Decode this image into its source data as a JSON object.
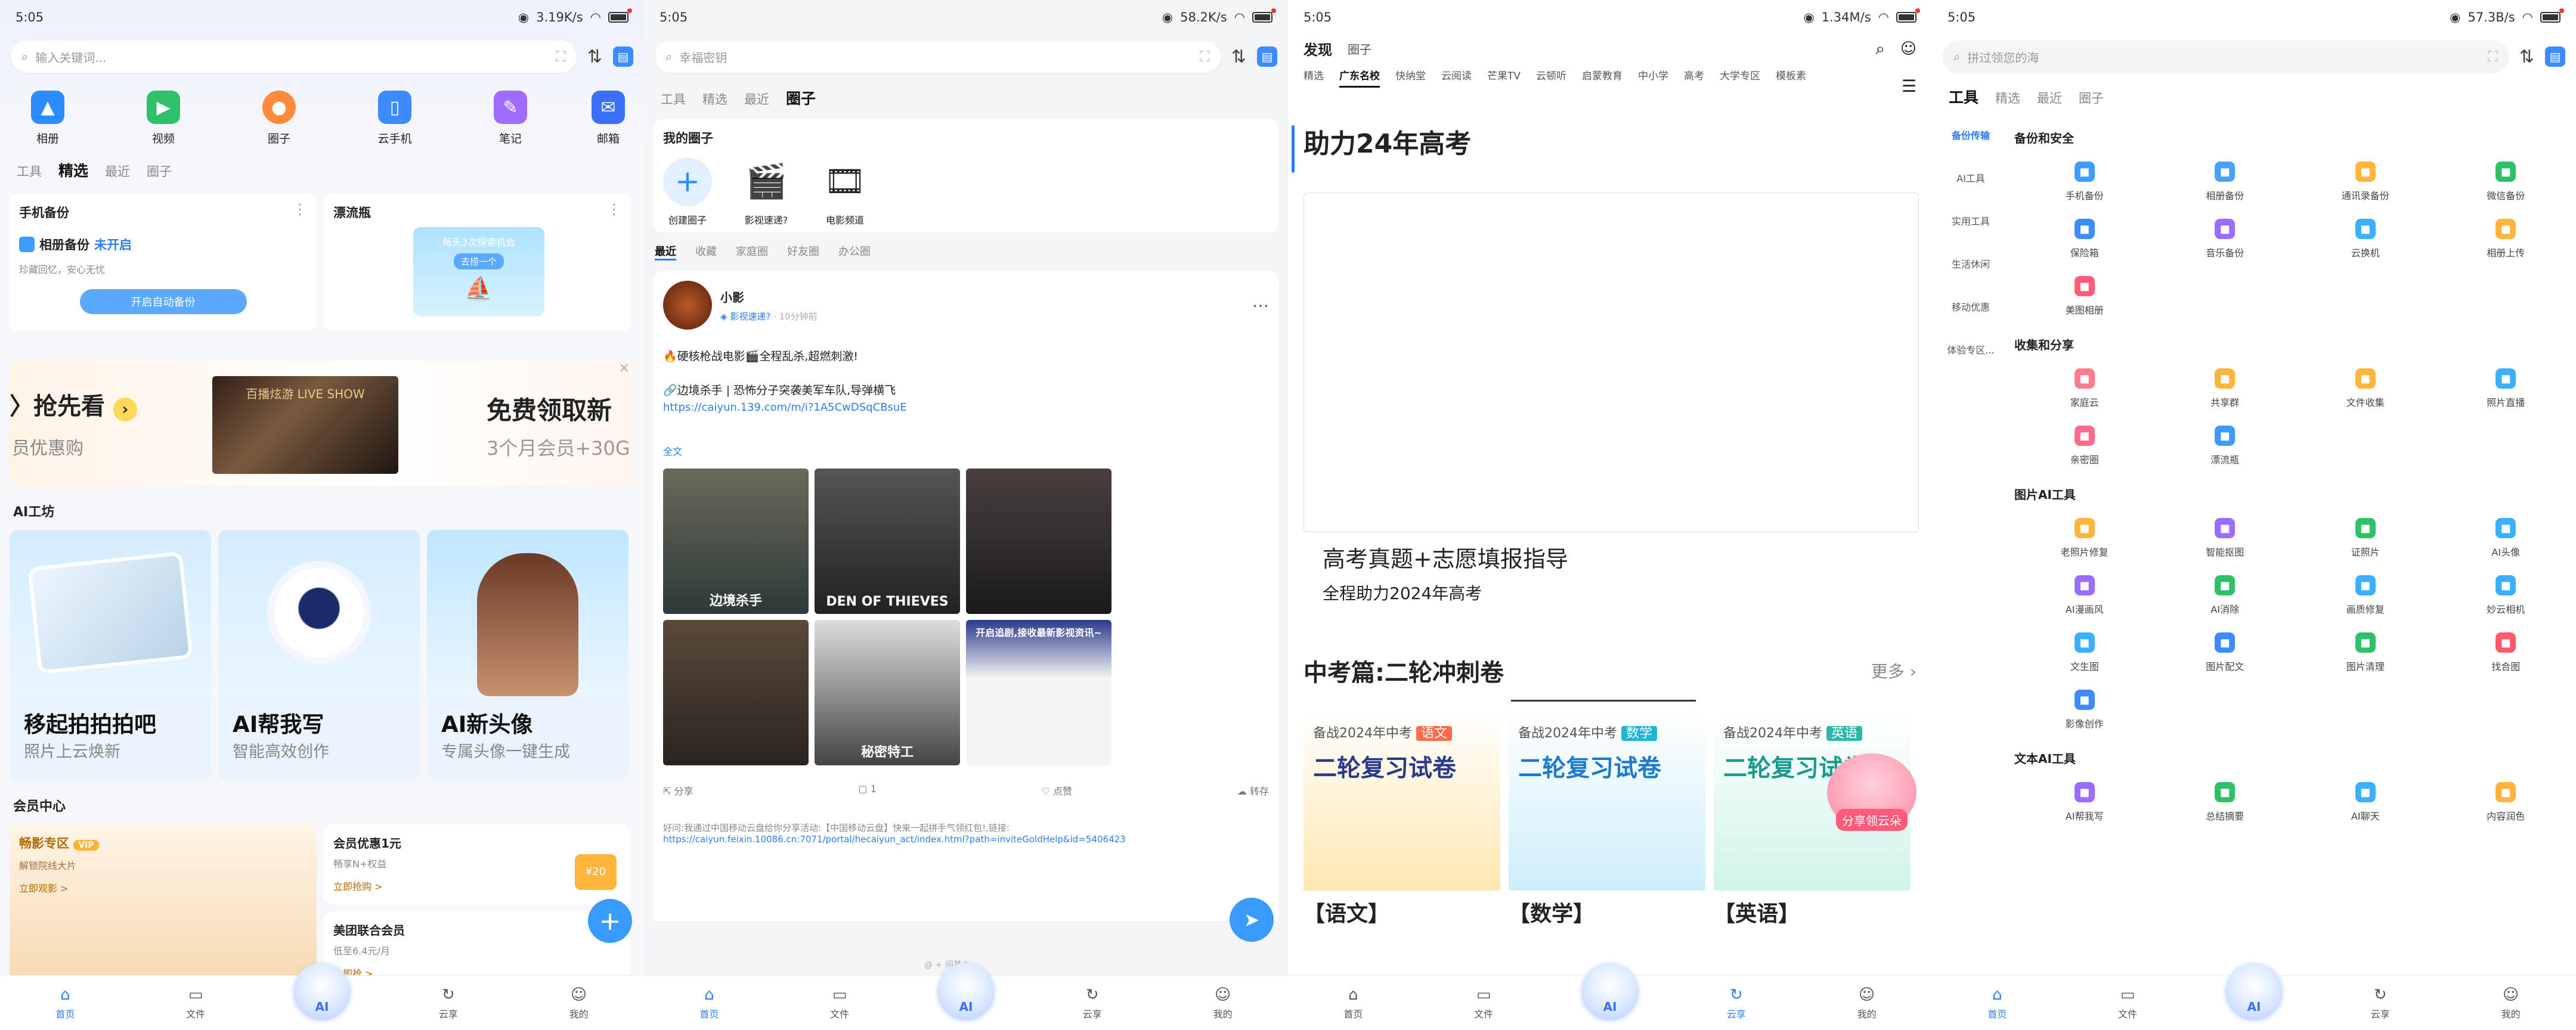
{
  "panels": [
    {
      "status": {
        "time": "5:05",
        "net": "3.19K/s"
      },
      "search": {
        "placeholder": "输入关键词..."
      },
      "quick": [
        {
          "label": "相册",
          "icon": "photo-icon",
          "color": "#2b8cff"
        },
        {
          "label": "视频",
          "icon": "video-icon",
          "color": "#2fc16a"
        },
        {
          "label": "圈子",
          "icon": "circle-icon",
          "color": "#ff8a3c"
        },
        {
          "label": "云手机",
          "icon": "cloud-phone-icon",
          "color": "#3e8bff"
        },
        {
          "label": "笔记",
          "icon": "note-icon",
          "color": "#a06cff"
        },
        {
          "label": "邮箱",
          "icon": "mail-icon",
          "color": "#3b6ff5"
        }
      ],
      "tabs": [
        "工具",
        "精选",
        "最近",
        "圈子"
      ],
      "backup": {
        "title": "手机备份",
        "line1": "相册备份",
        "status": "未开启",
        "line2": "珍藏回忆，安心无忧",
        "button": "开启自动备份"
      },
      "drift": {
        "title": "漂流瓶",
        "tip": "每天3次探索机会",
        "go": "去捞一个"
      },
      "banner": {
        "left": "抢先看",
        "left_sub": "员优惠购",
        "poster": "百播炫游 LIVE SHOW",
        "right": "免费领取新",
        "right_sub": "3个月会员+30G"
      },
      "ai_title": "AI工坊",
      "ai_cards": [
        {
          "title": "移起拍拍拍吧",
          "sub": "照片上云焕新"
        },
        {
          "title": "AI帮我写",
          "sub": "智能高效创作"
        },
        {
          "title": "AI新头像",
          "sub": "专属头像一键生成"
        }
      ],
      "member_title": "会员中心",
      "member": {
        "vip": "畅影专区",
        "vip_badge": "VIP",
        "vip_sub": "解锁院线大片",
        "vip_link": "立即观影 >",
        "offer1": "会员优惠1元",
        "offer1_sub": "畅享N+权益",
        "offer1_link": "立即抢购 >",
        "offer2": "美团联合会员",
        "offer2_sub": "低至6.4元/月",
        "offer2_link": "立即抢 >",
        "offer1_badge": "¥20"
      }
    },
    {
      "status": {
        "time": "5:05",
        "net": "58.2K/s"
      },
      "search": {
        "placeholder": "幸福密钥"
      },
      "tabs": [
        "工具",
        "精选",
        "最近",
        "圈子"
      ],
      "mine_title": "我的圈子",
      "circles": [
        {
          "label": "创建圈子"
        },
        {
          "label": "影视速递?"
        },
        {
          "label": "电影频道"
        }
      ],
      "subtabs": [
        "最近",
        "收藏",
        "家庭圈",
        "好友圈",
        "办公圈"
      ],
      "post": {
        "user": "小影",
        "source": "影视速递?",
        "time": "· 10分钟前",
        "line1": "🔥硬核枪战电影🎬全程乱杀,超燃刺激!",
        "line2": "🔗边境杀手 | 恐怖分子突袭美军车队,导弹横飞",
        "link": "https://caiyun.139.com/m/i?1A5CwDSqCBsuE",
        "expand": "全文",
        "images": [
          "边境杀手",
          "DEN OF THIEVES",
          "",
          "",
          "秘密特工",
          "开启追剧,接收最新影视资讯~"
        ],
        "share": "分享",
        "comments": "1",
        "likes": "点赞",
        "forward": "转存",
        "invite": "好问:我通过中国移动云盘给你分享活动:【中国移动云盘】快来一起拼手气领红包!,链接:",
        "invite_link": "https://caiyun.feixin.10086.cn:7071/portal/hecaiyun_act/index.html?path=inviteGoldHelp&id=5406423"
      },
      "toast": "@ + 问某Ａ"
    },
    {
      "status": {
        "time": "5:05",
        "net": "1.34M/s"
      },
      "top": {
        "title": "发现",
        "sub": "圈子"
      },
      "tabs": [
        "精选",
        "广东名校",
        "快纳堂",
        "云阅读",
        "芒果TV",
        "云顿听",
        "启蒙教育",
        "中小学",
        "高考",
        "大学专区",
        "模板素"
      ],
      "active_tab": 1,
      "hero_title": "助力24年高考",
      "hero_card_title": "高考真题+志愿填报指导",
      "hero_card_sub": "全程助力2024年高考",
      "mid_title": "中考篇:二轮冲刺卷",
      "more": "更多",
      "books": [
        {
          "top": "备战2024年中考",
          "tag": "语文",
          "title": "二轮复习试卷",
          "name": "【语文】",
          "color": "#ff6a4a"
        },
        {
          "top": "备战2024年中考",
          "tag": "数学",
          "title": "二轮复习试卷",
          "name": "【数学】",
          "color": "#1fb5d6"
        },
        {
          "top": "备战2024年中考",
          "tag": "英语",
          "title": "二轮复习试卷",
          "name": "【英语】",
          "color": "#2fb6a8"
        }
      ],
      "share_badge": "分享领云朵"
    },
    {
      "status": {
        "time": "5:05",
        "net": "57.3B/s"
      },
      "search": {
        "placeholder": "拼过领您的海"
      },
      "tabs": [
        "工具",
        "精选",
        "最近",
        "圈子"
      ],
      "side": [
        "备份传输",
        "AI工具",
        "实用工具",
        "生活休闲",
        "移动优惠",
        "体验专区..."
      ],
      "groups": [
        {
          "title": "备份和安全",
          "items": [
            {
              "label": "手机备份",
              "icon": "phone-backup-icon",
              "color": "#3e9bff"
            },
            {
              "label": "相册备份",
              "icon": "album-backup-icon",
              "color": "#4aa0ff"
            },
            {
              "label": "通讯录备份",
              "icon": "contacts-icon",
              "color": "#ffb43c"
            },
            {
              "label": "微信备份",
              "icon": "wechat-icon",
              "color": "#2fc16a"
            },
            {
              "label": "保险箱",
              "icon": "safe-icon",
              "color": "#3e8bff"
            },
            {
              "label": "音乐备份",
              "icon": "music-icon",
              "color": "#9a6cff"
            },
            {
              "label": "云换机",
              "icon": "switch-icon",
              "color": "#3ab0ff"
            },
            {
              "label": "相册上传",
              "icon": "upload-icon",
              "color": "#ffb43c"
            },
            {
              "label": "美图相册",
              "icon": "beauty-icon",
              "color": "#ff5a7a"
            }
          ]
        },
        {
          "title": "收集和分享",
          "items": [
            {
              "label": "家庭云",
              "icon": "family-icon",
              "color": "#ff7a8a"
            },
            {
              "label": "共享群",
              "icon": "group-icon",
              "color": "#ffb43c"
            },
            {
              "label": "文件收集",
              "icon": "collect-icon",
              "color": "#ffb43c"
            },
            {
              "label": "照片直播",
              "icon": "live-icon",
              "color": "#3ab0ff"
            },
            {
              "label": "亲密圈",
              "icon": "heart-icon",
              "color": "#ff6a8a"
            },
            {
              "label": "漂流瓶",
              "icon": "bottle-icon",
              "color": "#3e9bff"
            }
          ]
        },
        {
          "title": "图片AI工具",
          "items": [
            {
              "label": "老照片修复",
              "icon": "old-photo-icon",
              "color": "#ffb43c"
            },
            {
              "label": "智能抠图",
              "icon": "cutout-icon",
              "color": "#9a6cff"
            },
            {
              "label": "证照片",
              "icon": "id-photo-icon",
              "color": "#2fc16a"
            },
            {
              "label": "AI头像",
              "icon": "avatar-icon",
              "color": "#3ab0ff"
            },
            {
              "label": "AI漫画风",
              "icon": "comic-icon",
              "color": "#9a6cff"
            },
            {
              "label": "AI消除",
              "icon": "erase-icon",
              "color": "#2fc16a"
            },
            {
              "label": "画质修复",
              "icon": "quality-icon",
              "color": "#3ab0ff"
            },
            {
              "label": "妙云相机",
              "icon": "camera-icon",
              "color": "#3ab0ff"
            },
            {
              "label": "文生图",
              "icon": "text-image-icon",
              "color": "#3ab0ff"
            },
            {
              "label": "图片配文",
              "icon": "caption-icon",
              "color": "#3e8bff"
            },
            {
              "label": "图片清理",
              "icon": "clean-icon",
              "color": "#2fc16a"
            },
            {
              "label": "找合图",
              "icon": "find-icon",
              "color": "#ff5a6a"
            },
            {
              "label": "影像创作",
              "icon": "create-icon",
              "color": "#3e8bff"
            }
          ]
        },
        {
          "title": "文本AI工具",
          "items": [
            {
              "label": "AI帮我写",
              "icon": "write-icon",
              "color": "#9a6cff"
            },
            {
              "label": "总结摘要",
              "icon": "summary-icon",
              "color": "#2fc16a"
            },
            {
              "label": "AI聊天",
              "icon": "chat-icon",
              "color": "#3ab0ff"
            },
            {
              "label": "内容润色",
              "icon": "polish-icon",
              "color": "#ffb43c"
            }
          ]
        }
      ]
    }
  ],
  "nav": [
    "首页",
    "文件",
    "AI",
    "云享",
    "我的"
  ]
}
